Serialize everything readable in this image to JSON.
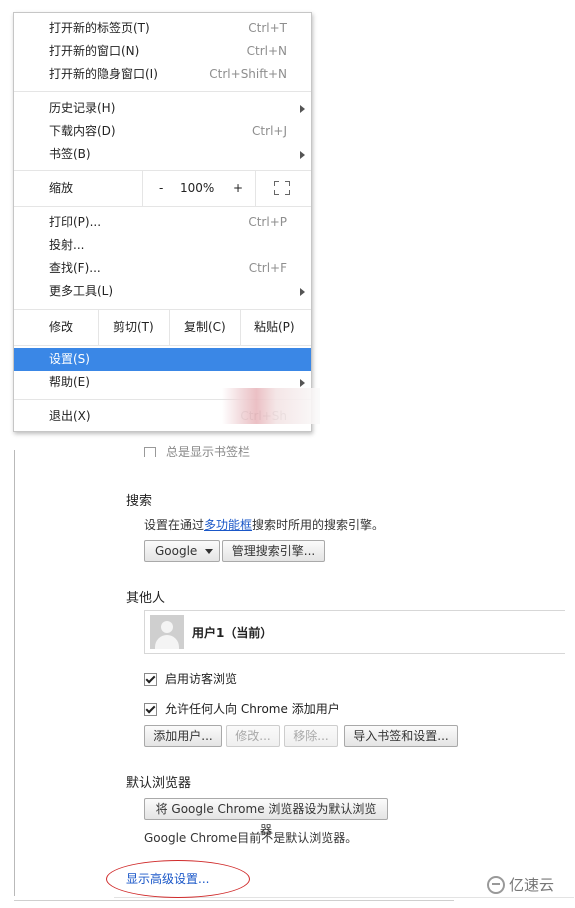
{
  "menu": {
    "items_group1": [
      {
        "label": "打开新的标签页(T)",
        "shortcut": "Ctrl+T"
      },
      {
        "label": "打开新的窗口(N)",
        "shortcut": "Ctrl+N"
      },
      {
        "label": "打开新的隐身窗口(I)",
        "shortcut": "Ctrl+Shift+N"
      }
    ],
    "items_group2": [
      {
        "label": "历史记录(H)",
        "shortcut": ""
      },
      {
        "label": "下载内容(D)",
        "shortcut": "Ctrl+J"
      },
      {
        "label": "书签(B)",
        "shortcut": ""
      }
    ],
    "zoom": {
      "label": "缩放",
      "minus": "-",
      "value": "100%",
      "plus": "+",
      "fullscreen_icon": "fullscreen-icon"
    },
    "items_group3": [
      {
        "label": "打印(P)...",
        "shortcut": "Ctrl+P"
      },
      {
        "label": "投射...",
        "shortcut": ""
      },
      {
        "label": "查找(F)...",
        "shortcut": "Ctrl+F"
      },
      {
        "label": "更多工具(L)",
        "shortcut": ""
      }
    ],
    "edit": {
      "label": "修改",
      "cut": "剪切(T)",
      "copy": "复制(C)",
      "paste": "粘贴(P)"
    },
    "settings": {
      "label": "设置(S)"
    },
    "help": {
      "label": "帮助(E)"
    },
    "exit": {
      "label": "退出(X)",
      "shortcut": "Ctrl+Sh"
    }
  },
  "settings_page": {
    "partial_row_text": "总是显示书签栏",
    "search": {
      "title": "搜索",
      "help_prefix": "设置在通过",
      "help_link": "多功能框",
      "help_suffix": "搜索时所用的搜索引擎。",
      "engine": "Google",
      "manage_button": "管理搜索引擎..."
    },
    "people": {
      "title": "其他人",
      "user_name": "用户1（当前）",
      "guest_checkbox": "启用访客浏览",
      "add_anyone_checkbox": "允许任何人向 Chrome 添加用户",
      "add_user_button": "添加用户...",
      "edit_button": "修改...",
      "remove_button": "移除...",
      "import_button": "导入书签和设置..."
    },
    "default_browser": {
      "title": "默认浏览器",
      "make_default_button": "将 Google Chrome 浏览器设为默认浏览器",
      "status": "Google Chrome目前不是默认浏览器。"
    },
    "advanced_link": "显示高级设置..."
  },
  "watermark": {
    "text": "亿速云"
  }
}
